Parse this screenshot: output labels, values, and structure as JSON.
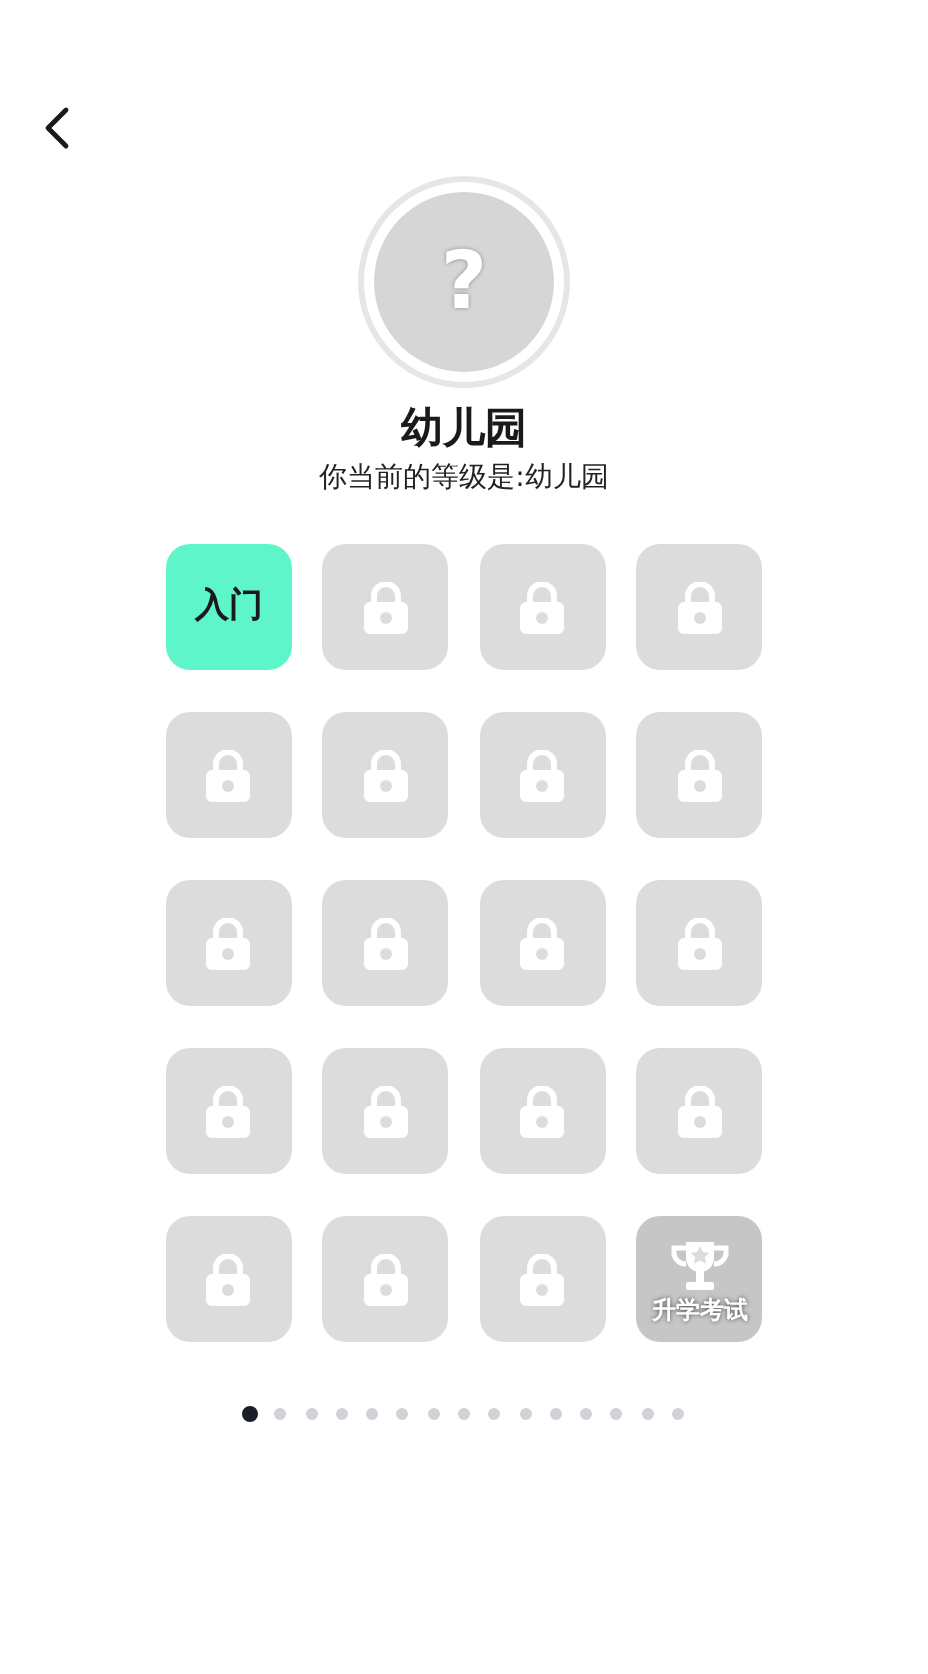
{
  "avatar": {
    "glyph": "?"
  },
  "level_title": "幼儿园",
  "level_subtitle": "你当前的等级是:幼儿园",
  "tiles": [
    {
      "kind": "unlocked",
      "label": "入门"
    },
    {
      "kind": "locked"
    },
    {
      "kind": "locked"
    },
    {
      "kind": "locked"
    },
    {
      "kind": "locked"
    },
    {
      "kind": "locked"
    },
    {
      "kind": "locked"
    },
    {
      "kind": "locked"
    },
    {
      "kind": "locked"
    },
    {
      "kind": "locked"
    },
    {
      "kind": "locked"
    },
    {
      "kind": "locked"
    },
    {
      "kind": "locked"
    },
    {
      "kind": "locked"
    },
    {
      "kind": "locked"
    },
    {
      "kind": "locked"
    },
    {
      "kind": "locked"
    },
    {
      "kind": "locked"
    },
    {
      "kind": "locked"
    },
    {
      "kind": "exam",
      "label": "升学考试"
    }
  ],
  "pages": [
    {
      "selected": true
    },
    {
      "selected": false
    },
    {
      "selected": false
    },
    {
      "selected": false
    },
    {
      "selected": false
    },
    {
      "selected": false
    },
    {
      "selected": false
    },
    {
      "selected": false
    },
    {
      "selected": false
    },
    {
      "selected": false
    },
    {
      "selected": false
    },
    {
      "selected": false
    },
    {
      "selected": false
    },
    {
      "selected": false
    },
    {
      "selected": false
    }
  ]
}
